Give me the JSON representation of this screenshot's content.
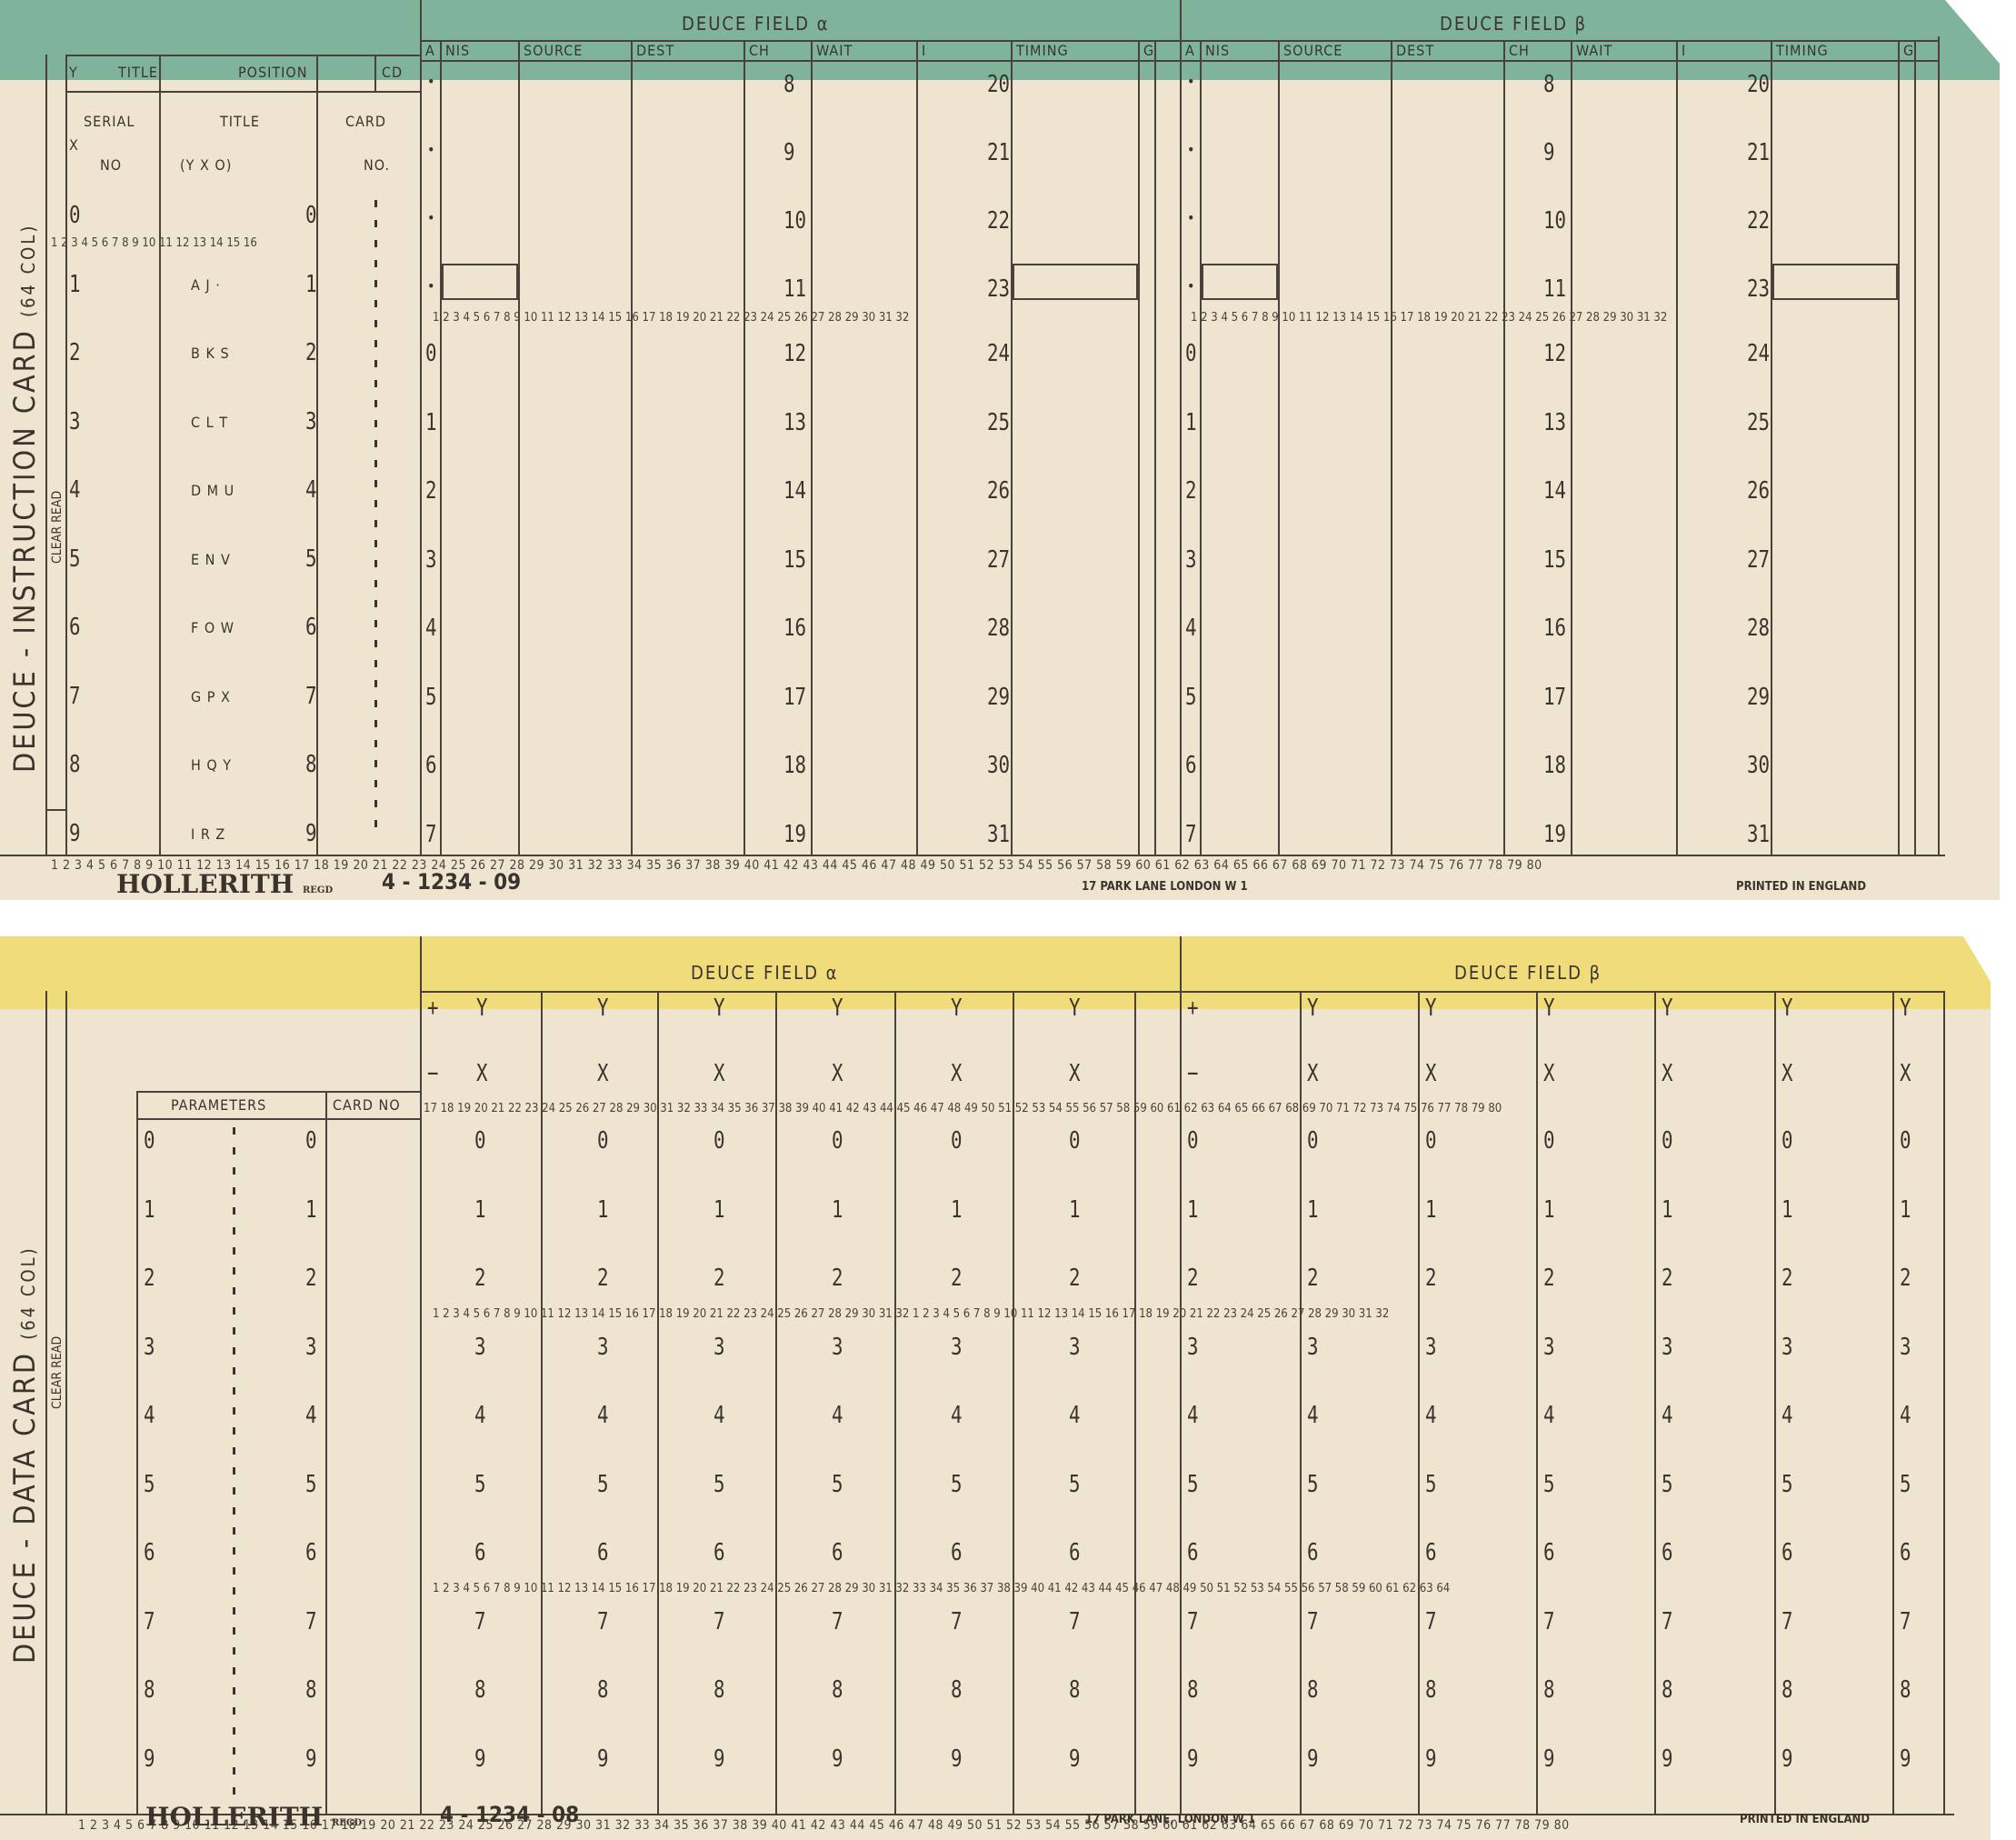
{
  "instruction_card": {
    "side_title": "DEUCE - INSTRUCTION CARD",
    "side_cols": "(64 COL)",
    "clear_read": "CLEAR READ",
    "band_color": "#7fb39c",
    "field_alpha": "DEUCE FIELD α",
    "field_beta": "DEUCE FIELD β",
    "left_headers": {
      "y": "Y",
      "title": "TITLE",
      "position": "POSITION",
      "cd": "CD",
      "x": "X",
      "serial": "SERIAL",
      "no": "NO",
      "title2": "TITLE",
      "yxo": "(Y X O)",
      "card": "CARD",
      "cardno": "NO."
    },
    "field_headers": [
      "A",
      "NIS",
      "SOURCE",
      "DEST",
      "CH",
      "WAIT",
      "I",
      "TIMING",
      "G"
    ],
    "left_rows": [
      {
        "d": "0",
        "letters": ""
      },
      {
        "d": "1",
        "letters": "A J ·"
      },
      {
        "d": "2",
        "letters": "B K S"
      },
      {
        "d": "3",
        "letters": "C L T"
      },
      {
        "d": "4",
        "letters": "D M U"
      },
      {
        "d": "5",
        "letters": "E N V"
      },
      {
        "d": "6",
        "letters": "F O W"
      },
      {
        "d": "7",
        "letters": "G P X"
      },
      {
        "d": "8",
        "letters": "H Q Y"
      },
      {
        "d": "9",
        "letters": "I R Z"
      }
    ],
    "ch_top": [
      "8",
      "9",
      "10",
      "11"
    ],
    "i_top": [
      "20",
      "21",
      "22",
      "23"
    ],
    "a_lower": [
      "0",
      "1",
      "2",
      "3",
      "4",
      "5",
      "6",
      "7"
    ],
    "ch_lower": [
      "12",
      "13",
      "14",
      "15",
      "16",
      "17",
      "18",
      "19"
    ],
    "i_lower": [
      "24",
      "25",
      "26",
      "27",
      "28",
      "29",
      "30",
      "31"
    ],
    "inner_col_numbers": "1 2 3 4 5 6 7 8 9 10 11 12 13 14 15 16 17 18 19 20 21 22 23 24 25 26 27 28 29 30 31 32",
    "left_col_numbers": "1 2 3 4 5 6 7 8 9 10 11 12 13 14 15 16",
    "bottom_col_numbers": "1 2 3 4 5 6 7 8 9 10 11 12 13 14 15 16 17 18 19 20 21 22 23 24 25 26 27 28 29 30 31 32 33 34 35 36 37 38 39 40 41 42 43 44 45 46 47 48 49 50 51 52 53 54 55 56 57 58 59 60 61 62 63 64 65 66 67 68 69 70 71 72 73 74 75 76 77 78 79 80",
    "maker": "HOLLERITH",
    "regd": "REGD",
    "form_no": "4 - 1234 - 09",
    "address": "17 PARK LANE LONDON W 1",
    "printed": "PRINTED IN ENGLAND"
  },
  "data_card": {
    "side_title": "DEUCE - DATA CARD",
    "side_cols": "(64 COL)",
    "clear_read": "CLEAR READ",
    "band_color": "#f0dc7a",
    "field_alpha": "DEUCE FIELD α",
    "field_beta": "DEUCE FIELD β",
    "parameters": "PARAMETERS",
    "card_no": "CARD NO",
    "plus": "+",
    "minus": "−",
    "y": "Y",
    "x": "X",
    "digits": [
      "0",
      "1",
      "2",
      "3",
      "4",
      "5",
      "6",
      "7",
      "8",
      "9"
    ],
    "top_col_numbers": "17 18 19 20 21 22 23 24 25 26 27 28 29 30 31 32 33 34 35 36 37 38 39 40 41 42 43 44 45 46 47 48 49 50 51 52 53 54 55 56 57 58 59 60 61 62 63 64 65 66 67 68 69 70 71 72 73 74 75 76 77 78 79 80",
    "mid_col_numbers": "1 2 3 4 5 6 7 8 9 10 11 12 13 14 15 16 17 18 19 20 21 22 23 24 25 26 27 28 29 30 31 32 1 2 3 4 5 6 7 8 9 10 11 12 13 14 15 16 17 18 19 20 21 22 23 24 25 26 27 28 29 30 31 32",
    "low_col_numbers": "1 2 3 4 5 6 7 8 9 10 11 12 13 14 15 16 17 18 19 20 21 22 23 24 25 26 27 28 29 30 31 32 33 34 35 36 37 38 39 40 41 42 43 44 45 46 47 48 49 50 51 52 53 54 55 56 57 58 59 60 61 62 63 64",
    "bottom_col_numbers": "1 2 3 4 5 6 7 8 9 10 11 12 13 14 15 16 17 18 19 20 21 22 23 24 25 26 27 28 29 30 31 32 33 34 35 36 37 38 39 40 41 42 43 44 45 46 47 48 49 50 51 52 53 54 55 56 57 58 59 60 61 62 63 64 65 66 67 68 69 70 71 72 73 74 75 76 77 78 79 80",
    "maker": "HOLLERITH",
    "regd": "REGD",
    "form_no": "4 - 1234 - 08",
    "address": "17 PARK LANE, LONDON W 1",
    "printed": "PRINTED IN ENGLAND"
  }
}
